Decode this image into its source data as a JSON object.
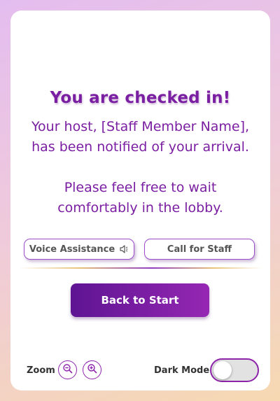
{
  "checkin": {
    "title": "You are checked in!",
    "host_line1": "Your host, [Staff Member Name],",
    "host_line2": "has been notified of your arrival.",
    "wait_line1": "Please feel free to wait",
    "wait_line2": "comfortably in the lobby."
  },
  "actions": {
    "voice_label": "Voice Assistance",
    "voice_icon": "speaker-icon",
    "call_label": "Call for Staff",
    "back_label": "Back to Start"
  },
  "footer": {
    "zoom_label": "Zoom",
    "zoom_out_icon": "zoom-out-icon",
    "zoom_in_icon": "zoom-in-icon",
    "dark_mode_label": "Dark Mode",
    "dark_mode_on": false
  },
  "colors": {
    "accent": "#7b1fa2",
    "button_gradient_start": "#5e1493",
    "button_gradient_end": "#9527b3",
    "card": "#ffffff"
  }
}
